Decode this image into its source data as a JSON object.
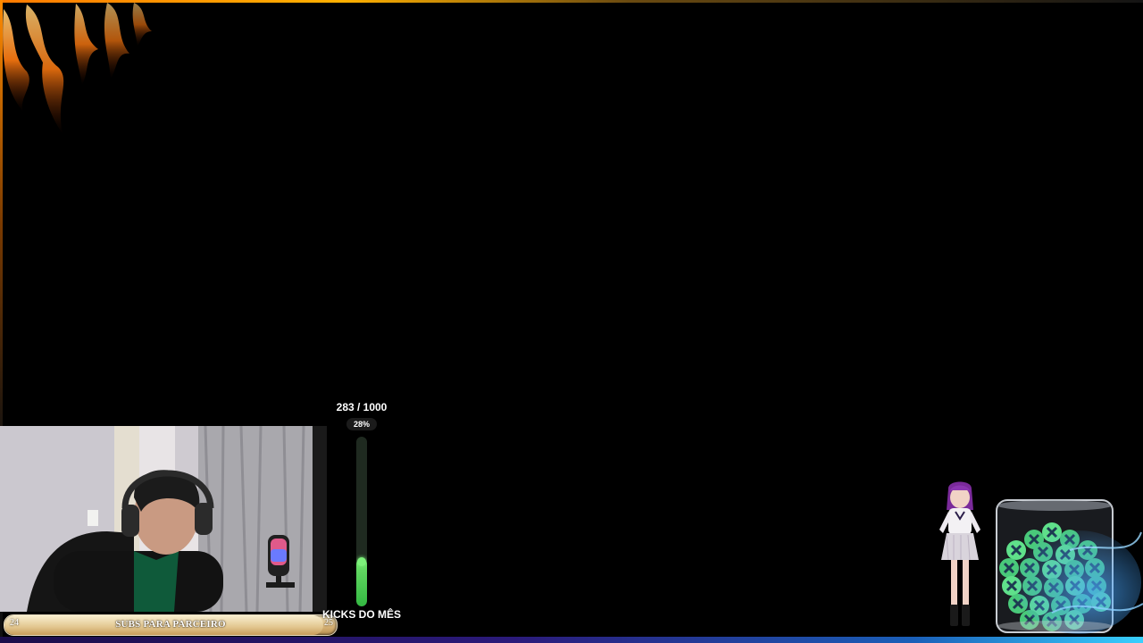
{
  "kicks_goal": {
    "current_text": "283 / 1000",
    "percent_text": "28%",
    "progress": 0.28,
    "title": "KICKS DO MÊS"
  },
  "subs_goal": {
    "start": "24",
    "end": "25",
    "label": "SUBS PARA PARCEIRO",
    "progress": 0.96
  },
  "colors": {
    "frame_orange": "#ff7a00",
    "frame_blue": "#38d0ff",
    "kicks_green": "#33b842",
    "subs_gold": "#d8b57a"
  },
  "icons": {
    "flames": "fire-decoration-icon",
    "jar": "kick-jar-icon",
    "avatar": "vtuber-avatar"
  }
}
